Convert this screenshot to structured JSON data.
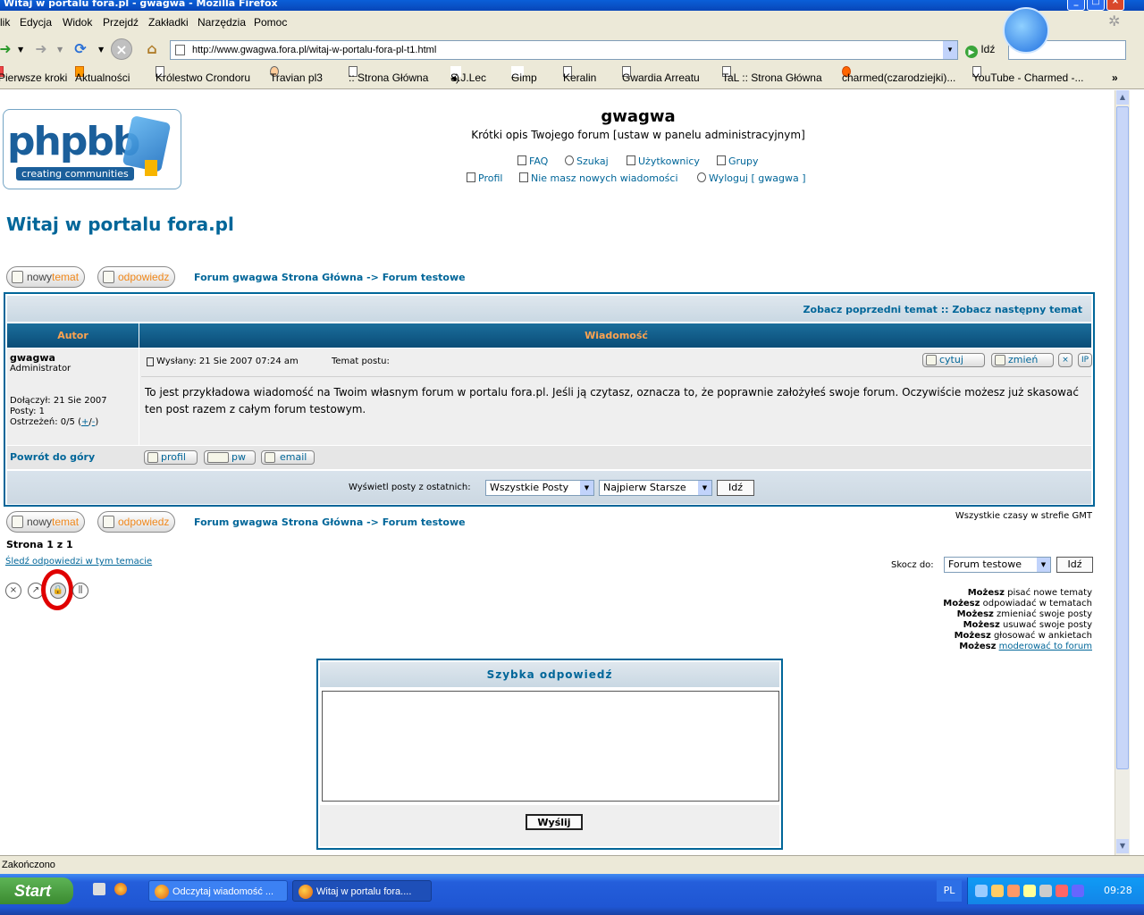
{
  "browser": {
    "window_title": "Witaj w portalu fora.pl - gwagwa - Mozilla Firefox",
    "menu": [
      "Plik",
      "Edycja",
      "Widok",
      "Przejdź",
      "Zakładki",
      "Narzędzia",
      "Pomoc"
    ],
    "url": "http://www.gwagwa.fora.pl/witaj-w-portalu-fora-pl-t1.html",
    "go_label": "Idź",
    "bookmarks": [
      "Pierwsze kroki",
      "Aktualności",
      "Królestwo Crondoru",
      "Travian pl3",
      ":: Strona Główna",
      "S.J.Lec",
      "Gimp",
      "Keralin",
      "Gwardia Arreatu",
      "TaL :: Strona Główna",
      "charmed(czarodziejki)...",
      "YouTube - Charmed -..."
    ],
    "status_text": "Zakończono"
  },
  "forum": {
    "logo_main": "phpbb",
    "logo_sub": "creating communities",
    "site_name": "gwagwa",
    "site_desc": "Krótki opis Twojego forum [ustaw w panelu administracyjnym]",
    "nav": {
      "faq": "FAQ",
      "search": "Szukaj",
      "users": "Użytkownicy",
      "groups": "Grupy",
      "profile": "Profil",
      "messages": "Nie masz nowych wiadomości",
      "logout": "Wyloguj [ gwagwa ]"
    },
    "topic_title": "Witaj w portalu fora.pl",
    "btn_new_a": "nowy",
    "btn_new_b": "temat",
    "btn_reply": "odpowiedz",
    "breadcrumb": "Forum gwagwa Strona Główna -> Forum testowe",
    "prev_next": "Zobacz poprzedni temat :: Zobacz następny temat",
    "col_author": "Autor",
    "col_message": "Wiadomość",
    "post": {
      "author": "gwagwa",
      "rank": "Administrator",
      "joined": "Dołączył: 21 Sie 2007",
      "posts": "Posty: 1",
      "warnings_prefix": "Ostrzeżeń: 0/5 (",
      "warnings_plus": "+",
      "warnings_sep": "/",
      "warnings_minus": "-",
      "warnings_suffix": ")",
      "sent": "Wysłany: 21 Sie 2007 07:24 am",
      "subject_label": "Temat postu:",
      "quote": "cytuj",
      "edit": "zmień",
      "delete_icon": "×",
      "ip_icon": "IP",
      "body": "To jest przykładowa wiadomość na Twoim własnym forum w portalu fora.pl. Jeśli ją czytasz, oznacza to, że poprawnie założyłeś swoje forum. Oczywiście możesz już skasować ten post razem z całym forum testowym.",
      "back_to_top": "Powrót do góry",
      "profile_btn": "profil",
      "pm_btn": "pw",
      "email_btn": "email"
    },
    "filter_label": "Wyświetl posty z ostatnich:",
    "filter_select": "Wszystkie Posty",
    "order_select": "Najpierw Starsze",
    "go_btn": "Idź",
    "timezone": "Wszystkie czasy w strefie GMT",
    "page_info": "Strona 1 z 1",
    "watch_topic": "Śledź odpowiedzi w tym temacie",
    "jump_label": "Skocz do:",
    "jump_select": "Forum testowe",
    "permissions": [
      {
        "b": "Możesz",
        "t": " pisać nowe tematy"
      },
      {
        "b": "Możesz",
        "t": " odpowiadać w tematach"
      },
      {
        "b": "Możesz",
        "t": " zmieniać swoje posty"
      },
      {
        "b": "Możesz",
        "t": " usuwać swoje posty"
      },
      {
        "b": "Możesz",
        "t": " głosować w ankietach"
      }
    ],
    "perm_moderate_b": "Możesz",
    "perm_moderate_link": "moderować to forum",
    "quick_reply_title": "Szybka odpowiedź",
    "send_btn": "Wyślij"
  },
  "taskbar": {
    "start": "Start",
    "tasks": [
      "Odczytaj wiadomość ...",
      "Witaj w portalu fora...."
    ],
    "lang": "PL",
    "clock": "09:28"
  },
  "colors": {
    "forum_link": "#006699",
    "header_orange": "#ffa34f",
    "highlight_red": "#e00000"
  }
}
